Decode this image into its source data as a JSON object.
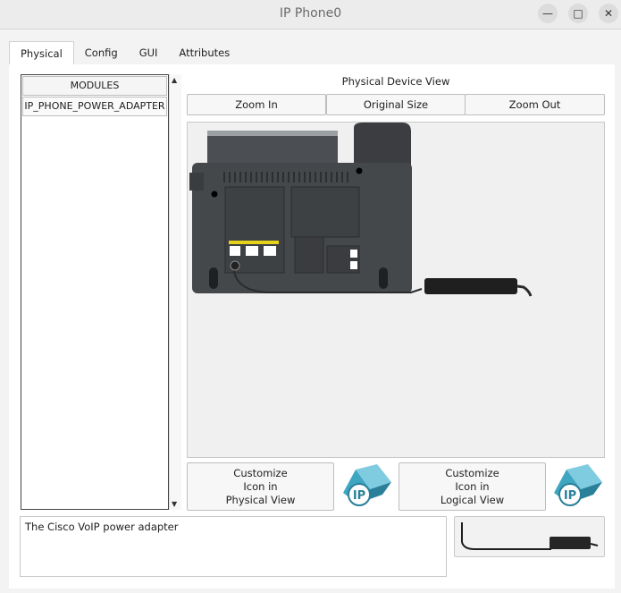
{
  "window": {
    "title": "IP Phone0"
  },
  "tabs": [
    {
      "label": "Physical",
      "active": true
    },
    {
      "label": "Config",
      "active": false
    },
    {
      "label": "GUI",
      "active": false
    },
    {
      "label": "Attributes",
      "active": false
    }
  ],
  "modules": {
    "header": "MODULES",
    "items": [
      "IP_PHONE_POWER_ADAPTER"
    ]
  },
  "device_view": {
    "label": "Physical Device View",
    "zoom_in": "Zoom In",
    "original_size": "Original Size",
    "zoom_out": "Zoom Out"
  },
  "customize": {
    "physical": [
      "Customize",
      "Icon in",
      "Physical View"
    ],
    "logical": [
      "Customize",
      "Icon in",
      "Logical View"
    ],
    "icon_text": "IP"
  },
  "description": "The Cisco VoIP power adapter",
  "colors": {
    "accent": "#1f3e63",
    "icon_teal": "#3fa6c1"
  }
}
